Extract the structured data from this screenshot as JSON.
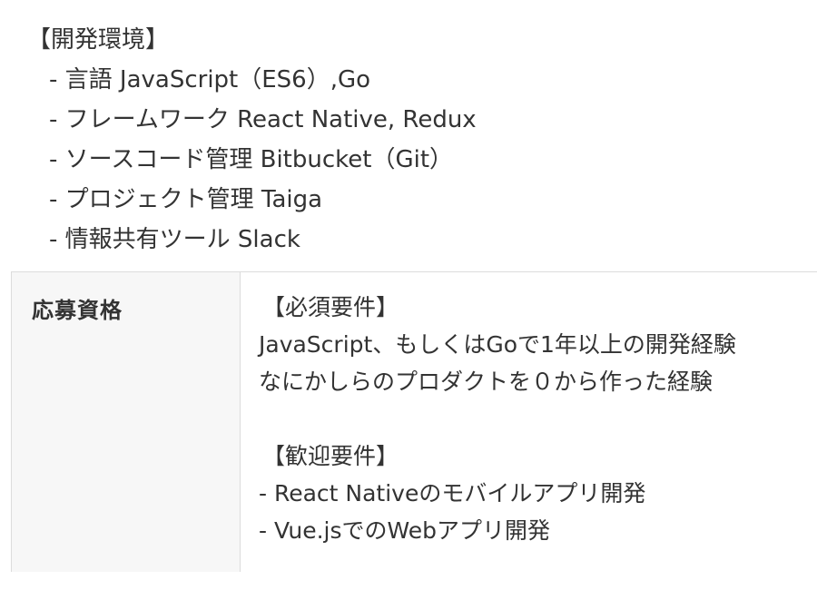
{
  "dev_environment": {
    "heading": "【開発環境】",
    "items": [
      "- 言語 JavaScript（ES6）,Go",
      "- フレームワーク React Native, Redux",
      "- ソースコード管理 Bitbucket（Git）",
      "- プロジェクト管理 Taiga",
      "- 情報共有ツール Slack"
    ]
  },
  "qualifications": {
    "label": "応募資格",
    "required_heading": "【必須要件】",
    "required_items": [
      "JavaScript、もしくはGoで1年以上の開発経験",
      "なにかしらのプロダクトを０から作った経験"
    ],
    "welcome_heading": "【歓迎要件】",
    "welcome_items": [
      "- React Nativeのモバイルアプリ開発",
      "- Vue.jsでのWebアプリ開発"
    ]
  },
  "colors": {
    "text": "#333333",
    "label_bg": "#f7f7f7",
    "border": "#dcdcdc"
  }
}
